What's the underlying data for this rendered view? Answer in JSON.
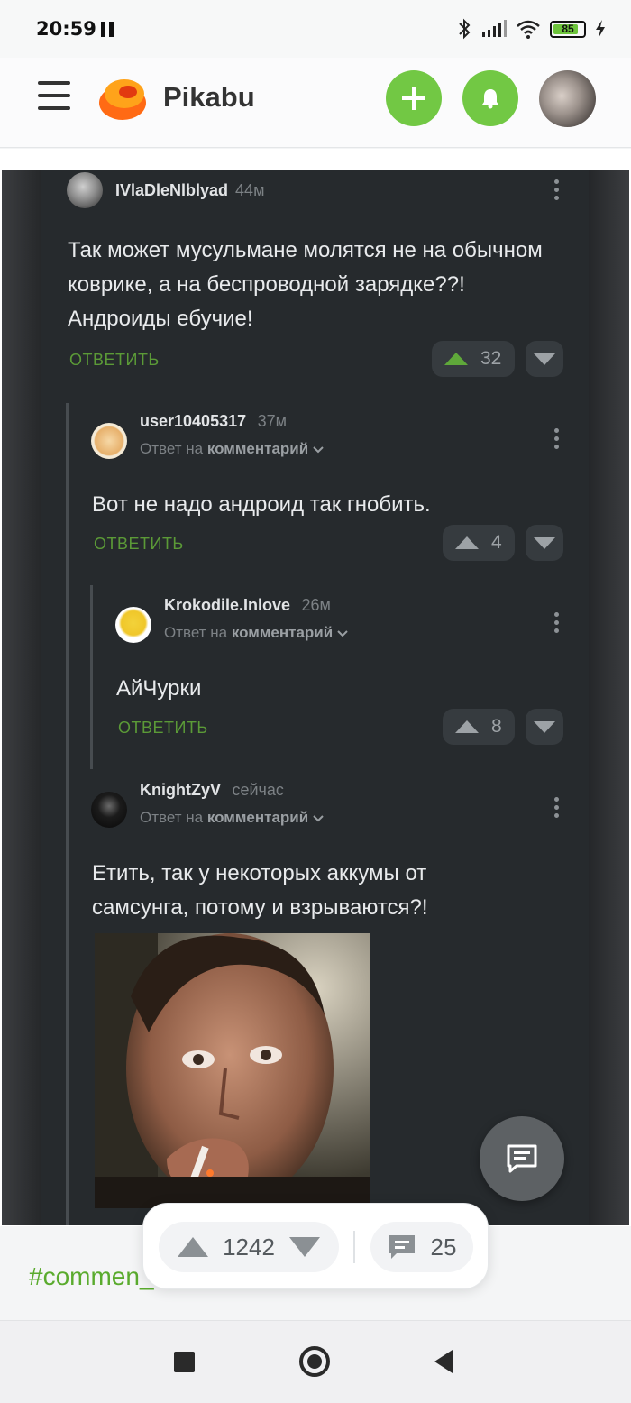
{
  "status_bar": {
    "time": "20:59",
    "battery": "85",
    "battery_level": 0.85
  },
  "header": {
    "brand": "Pikabu"
  },
  "comments": [
    {
      "user": "IVlaDleNlblyad",
      "time": "44м",
      "text": "Так может мусульмане молятся не на обычном коврике, а на беспроводной зарядке??! Андроиды ебучие!",
      "answer": "ОТВЕТИТЬ",
      "votes": "32"
    },
    {
      "user": "user10405317",
      "time": "37м",
      "reply_prefix": "Ответ на",
      "reply_target": "комментарий",
      "text": "Вот не надо андроид так гнобить.",
      "answer": "ОТВЕТИТЬ",
      "votes": "4"
    },
    {
      "user": "Krokodile.Inlove",
      "time": "26м",
      "reply_prefix": "Ответ на",
      "reply_target": "комментарий",
      "text": "АйЧурки",
      "answer": "ОТВЕТИТЬ",
      "votes": "8"
    },
    {
      "user": "KnightZyV",
      "time": "сейчас",
      "reply_prefix": "Ответ на",
      "reply_target": "комментарий",
      "text": "Етить, так у некоторых аккумы от самсунга, потому и взрываются?!"
    }
  ],
  "post_bar": {
    "rating": "1242",
    "comments": "25"
  },
  "tag": "#commen_",
  "colors": {
    "accent": "#72c844",
    "tag": "#5aab2e",
    "answer": "#5b9a37"
  },
  "icons": [
    "menu-icon",
    "pikabu-logo",
    "plus-icon",
    "bell-icon",
    "chat-bubble-icon",
    "arrow-up-icon",
    "arrow-down-icon",
    "kebab-icon"
  ]
}
